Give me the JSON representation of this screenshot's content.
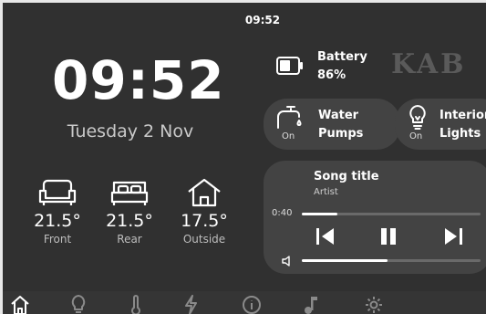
{
  "status_bar": {
    "time": "09:52"
  },
  "clock": {
    "time": "09:52",
    "date": "Tuesday 2 Nov"
  },
  "temperatures": [
    {
      "icon": "sofa-icon",
      "value": "21.5°",
      "label": "Front"
    },
    {
      "icon": "bed-icon",
      "value": "21.5°",
      "label": "Rear"
    },
    {
      "icon": "house-icon",
      "value": "17.5°",
      "label": "Outside"
    }
  ],
  "battery": {
    "label": "Battery",
    "value": "86%",
    "level": 0.86
  },
  "brand": {
    "logo": "KAB"
  },
  "tiles": [
    {
      "icon": "water-tap-icon",
      "name_line1": "Water",
      "name_line2": "Pumps",
      "state": "On"
    },
    {
      "icon": "lightbulb-icon",
      "name_line1": "Interior",
      "name_line2": "Lights",
      "state": "On"
    }
  ],
  "media": {
    "title": "Song title",
    "artist": "Artist",
    "position": "0:40",
    "progress": 0.2,
    "volume": 0.48
  },
  "nav": [
    "home-icon",
    "lightbulb-icon",
    "thermometer-icon",
    "power-icon",
    "info-icon",
    "music-note-icon",
    "settings-gear-icon"
  ],
  "colors": {
    "background": "#303030",
    "tile": "#434343",
    "text": "#ffffff",
    "muted": "#bdbdbd"
  }
}
